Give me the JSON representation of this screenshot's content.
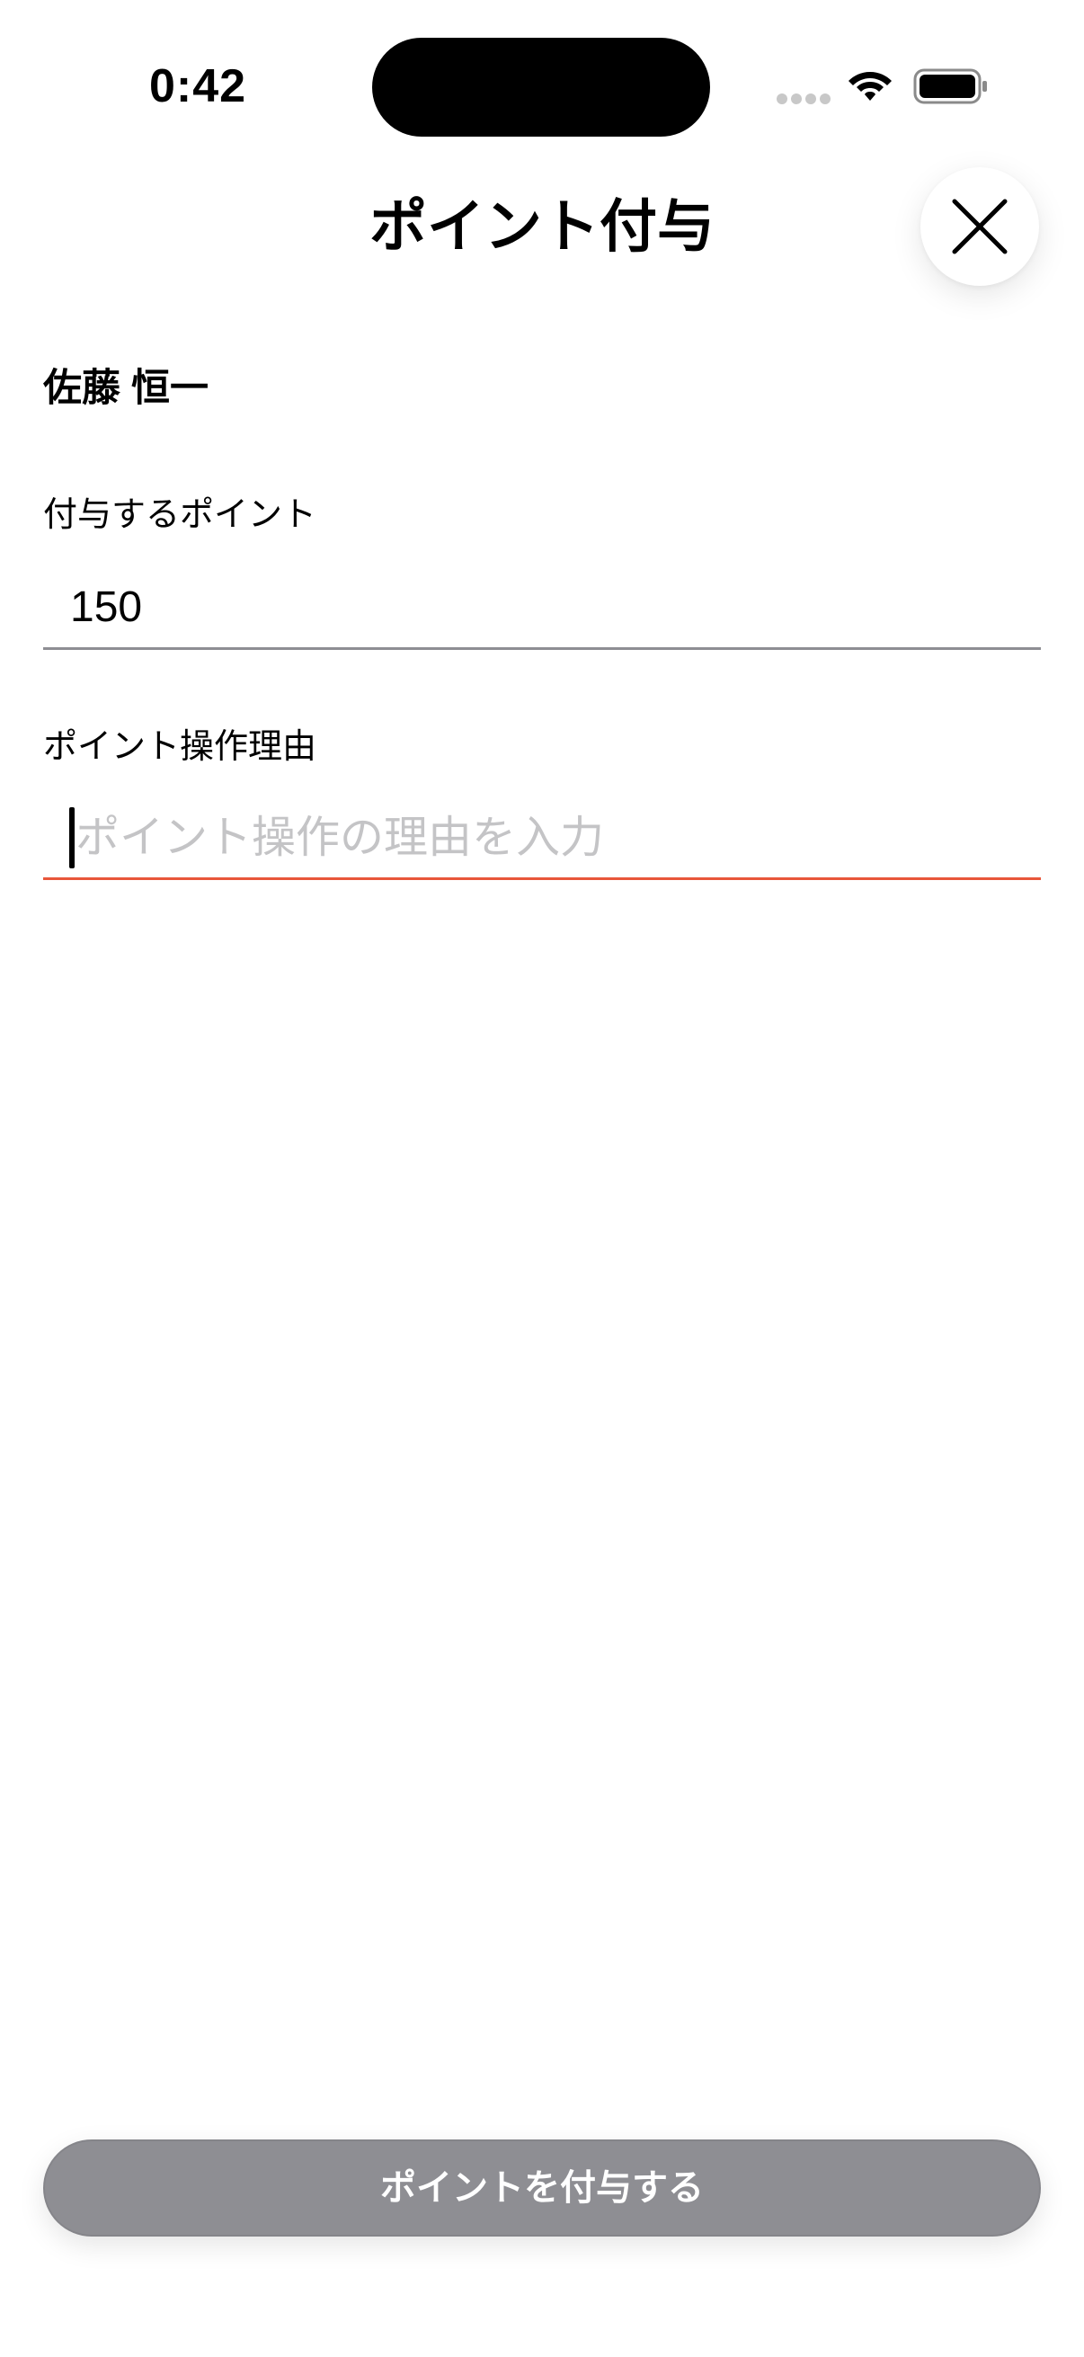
{
  "status_bar": {
    "time": "0:42"
  },
  "header": {
    "title": "ポイント付与",
    "close_icon": "close-icon"
  },
  "form": {
    "user_name": "佐藤 恒一",
    "points_label": "付与するポイント",
    "points_value": "150",
    "reason_label": "ポイント操作理由",
    "reason_placeholder": "ポイント操作の理由を入力",
    "reason_value": ""
  },
  "actions": {
    "submit_label": "ポイントを付与する"
  },
  "colors": {
    "active_underline": "#e8563a",
    "inactive_underline": "#8e8e93",
    "disabled_button": "#8e8e93",
    "placeholder": "#c4c4c6"
  },
  "icons": {
    "wifi": "wifi-icon",
    "battery": "battery-icon",
    "signal": "cellular-signal-icon"
  }
}
